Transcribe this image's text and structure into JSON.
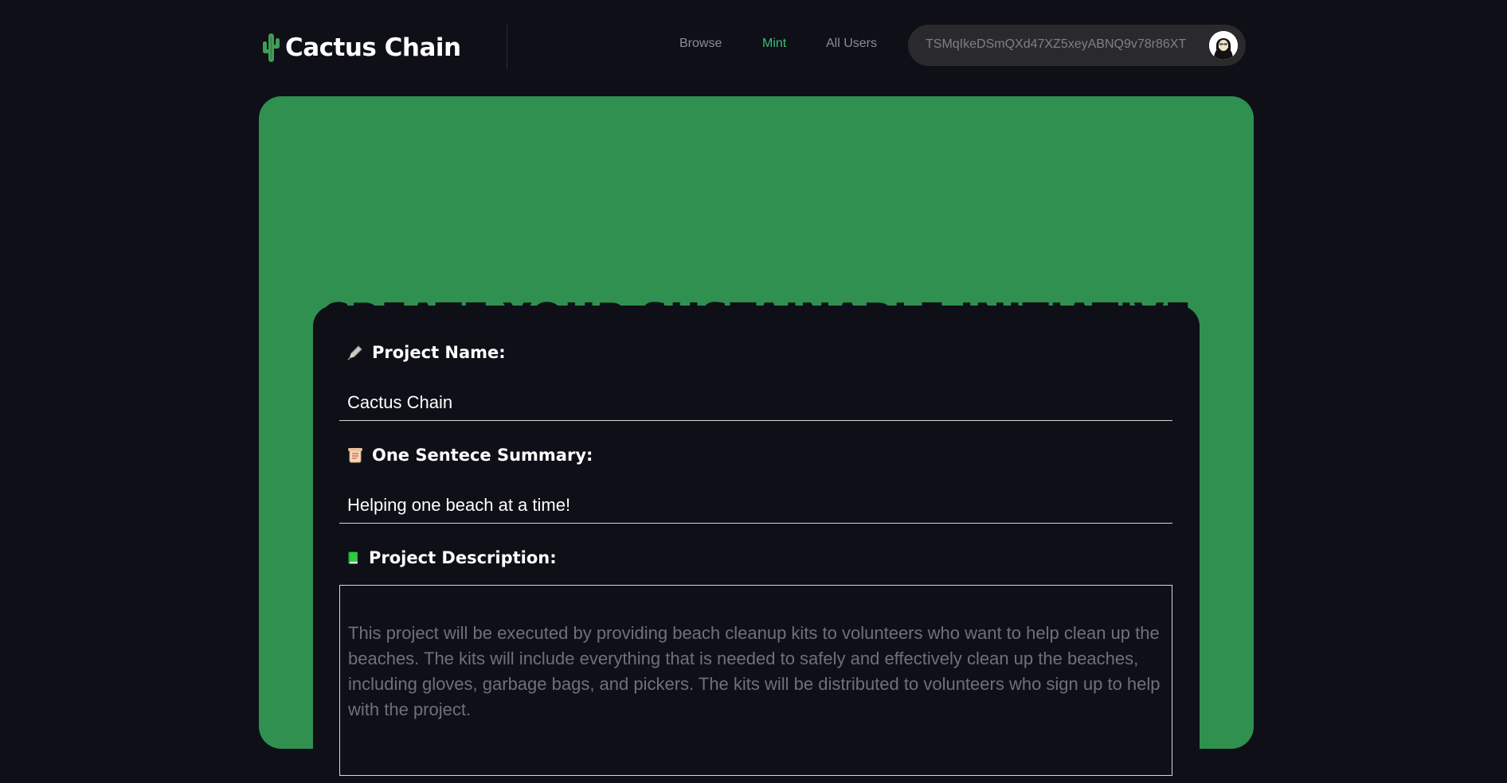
{
  "header": {
    "brand_name": "Cactus Chain",
    "brand_icon": "cactus-icon",
    "nav": [
      {
        "label": "Browse",
        "active": false
      },
      {
        "label": "Mint",
        "active": true
      },
      {
        "label": "All Users",
        "active": false
      }
    ],
    "wallet_address": "TSMqIkeDSmQXd47XZ5xeyABNQ9v78r86XT"
  },
  "hero": {
    "title": "CREATE YOUR SUSTAINABLE INITIATIVE"
  },
  "form": {
    "project_name": {
      "label": "Project Name:",
      "icon": "pen-icon",
      "value": "Cactus Chain"
    },
    "summary": {
      "label": "One Sentece Summary:",
      "icon": "scroll-icon",
      "value": "Helping one beach at a time!"
    },
    "description": {
      "label": "Project Description:",
      "icon": "green-book-icon",
      "placeholder": "This project will be executed by providing beach cleanup kits to volunteers who want to help clean up the beaches. The kits will include everything that is needed to safely and effectively clean up the beaches, including gloves, garbage bags, and pickers. The kits will be distributed to volunteers who sign up to help with the project."
    }
  },
  "colors": {
    "background": "#0e0f17",
    "hero_green": "#2f9050",
    "nav_active": "#3dbf74",
    "nav_inactive": "#8c8c96"
  }
}
